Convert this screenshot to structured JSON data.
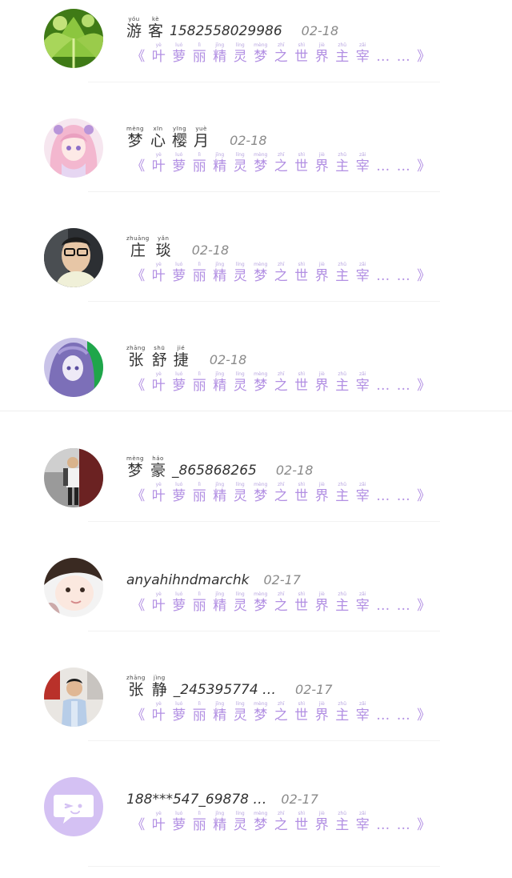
{
  "comments": [
    {
      "avatar": "celery-leaves",
      "name_chars": [
        {
          "hz": "游",
          "py": "yóu"
        },
        {
          "hz": "客",
          "py": "kè"
        }
      ],
      "name_tail": "1582558029986",
      "date": "02-18"
    },
    {
      "avatar": "anime-girl-pink",
      "name_chars": [
        {
          "hz": "梦",
          "py": "mèng"
        },
        {
          "hz": "心",
          "py": "xīn"
        },
        {
          "hz": "樱",
          "py": "yīng"
        },
        {
          "hz": "月",
          "py": "yuè"
        }
      ],
      "name_tail": "",
      "date": "02-18"
    },
    {
      "avatar": "man-glasses",
      "name_chars": [
        {
          "hz": "庄",
          "py": "zhuāng"
        },
        {
          "hz": "琰",
          "py": "yǎn"
        }
      ],
      "name_tail": "",
      "date": "02-18"
    },
    {
      "avatar": "anime-girl-purple",
      "name_chars": [
        {
          "hz": "张",
          "py": "zhāng"
        },
        {
          "hz": "舒",
          "py": "shū"
        },
        {
          "hz": "捷",
          "py": "jié"
        }
      ],
      "name_tail": "",
      "date": "02-18"
    },
    {
      "avatar": "boy-standing",
      "name_chars": [
        {
          "hz": "梦",
          "py": "mèng"
        },
        {
          "hz": "豪",
          "py": "háo"
        }
      ],
      "name_tail": "_865868265",
      "date": "02-18"
    },
    {
      "avatar": "selfie-girl",
      "name_chars": [],
      "name_tail": "anyahihndmarchk",
      "date": "02-17"
    },
    {
      "avatar": "child-photo",
      "name_chars": [
        {
          "hz": "张",
          "py": "zhāng"
        },
        {
          "hz": "静",
          "py": "jìng"
        }
      ],
      "name_tail": "_245395774 …",
      "date": "02-17"
    },
    {
      "avatar": "default-chat-icon",
      "name_chars": [],
      "name_tail": "188***547_69878 …",
      "date": "02-17"
    }
  ],
  "content_chars": [
    {
      "hz": "《",
      "py": ""
    },
    {
      "hz": "叶",
      "py": "yè"
    },
    {
      "hz": "萝",
      "py": "luó"
    },
    {
      "hz": "丽",
      "py": "lì"
    },
    {
      "hz": "精",
      "py": "jīng"
    },
    {
      "hz": "灵",
      "py": "líng"
    },
    {
      "hz": "梦",
      "py": "mèng"
    },
    {
      "hz": "之",
      "py": "zhī"
    },
    {
      "hz": "世",
      "py": "shì"
    },
    {
      "hz": "界",
      "py": "jiè"
    },
    {
      "hz": "主",
      "py": "zhǔ"
    },
    {
      "hz": "宰",
      "py": "zǎi"
    },
    {
      "hz": "…",
      "py": ""
    },
    {
      "hz": "…",
      "py": ""
    },
    {
      "hz": "》",
      "py": ""
    }
  ],
  "colors": {
    "content_purple": "#b28fe3",
    "date_gray": "#8a8a8a",
    "default_avatar_bg": "#d4c1f3"
  }
}
